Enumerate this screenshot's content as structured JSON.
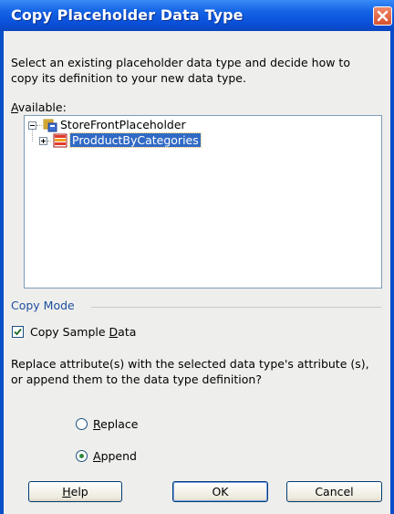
{
  "dialog": {
    "title": "Copy Placeholder Data Type",
    "intro": "Select an existing placeholder data type and decide how to copy its definition to your new data type.",
    "available_label_accel": "A",
    "available_label_rest": "vailable:",
    "tree": {
      "root": {
        "label": "StoreFrontPlaceholder",
        "icon": "datasource-icon",
        "expanded": true
      },
      "child": {
        "label": "ProdductByCategories",
        "icon": "data-type-icon",
        "selected": true
      }
    },
    "copy_mode": {
      "legend": "Copy Mode",
      "checkbox_pre": "Copy Sample ",
      "checkbox_accel": "D",
      "checkbox_post": "ata",
      "checkbox_checked": true,
      "question": "Replace attribute(s) with the selected data type's attribute (s), or append them to the data type definition?",
      "radios": [
        {
          "accel": "R",
          "rest": "eplace",
          "selected": false
        },
        {
          "accel": "A",
          "rest": "ppend",
          "selected": true
        }
      ]
    },
    "buttons": {
      "help_accel": "H",
      "help_rest": "elp",
      "ok": "OK",
      "cancel": "Cancel"
    },
    "colors": {
      "titlebar": "#0a4fd8",
      "selection": "#316ac5",
      "close": "#d8502e"
    }
  }
}
